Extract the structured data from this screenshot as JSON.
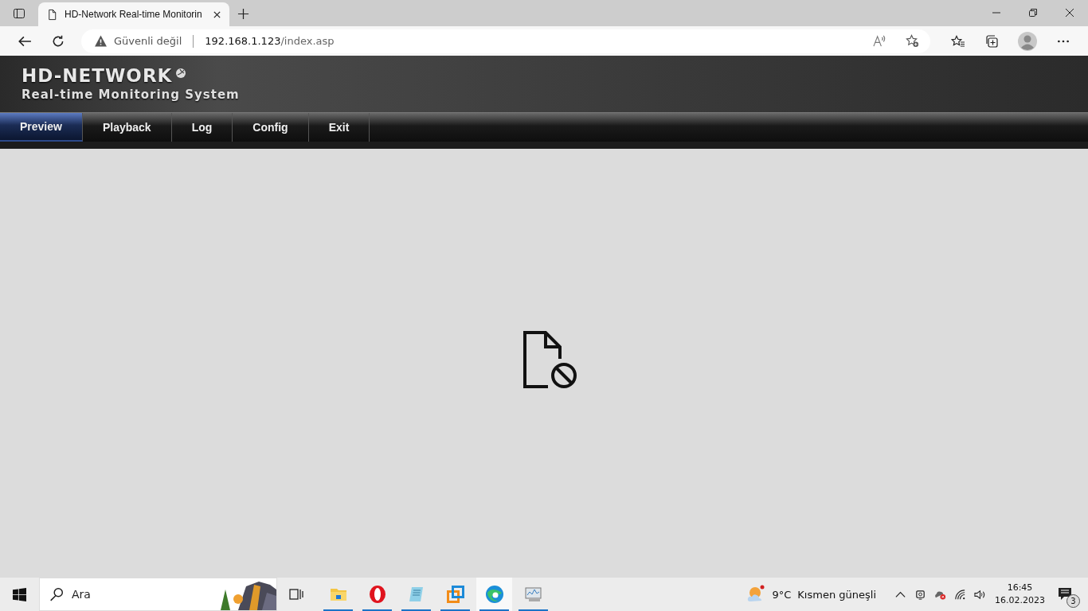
{
  "browser": {
    "tab_title": "HD-Network Real-time Monitorin",
    "security": "Güvenli değil",
    "url_host": "192.168.1.123",
    "url_path": "/index.asp"
  },
  "header": {
    "logo": "HD-NETWORK",
    "subtitle": "Real-time Monitoring System"
  },
  "nav": [
    {
      "label": "Preview",
      "selected": true
    },
    {
      "label": "Playback",
      "selected": false
    },
    {
      "label": "Log",
      "selected": false
    },
    {
      "label": "Config",
      "selected": false
    },
    {
      "label": "Exit",
      "selected": false
    }
  ],
  "taskbar": {
    "search_placeholder": "Ara",
    "apps": [
      {
        "kind": "folder",
        "selected": false
      },
      {
        "kind": "opera",
        "selected": false
      },
      {
        "kind": "notepad",
        "selected": false
      },
      {
        "kind": "vmware",
        "selected": false
      },
      {
        "kind": "edge",
        "selected": true
      },
      {
        "kind": "monitor",
        "selected": false
      }
    ],
    "temperature": "9°C",
    "weather": "Kısmen güneşli",
    "time": "16:45",
    "date": "16.02.2023",
    "notifications": "3"
  }
}
